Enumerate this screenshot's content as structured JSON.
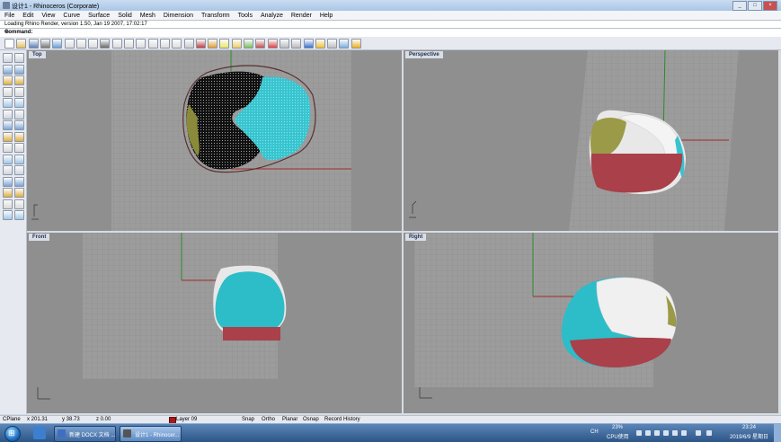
{
  "window": {
    "title": "设计1 - Rhinoceros (Corporate)",
    "minimize": "_",
    "maximize": "□",
    "close": "×"
  },
  "menu": [
    "File",
    "Edit",
    "View",
    "Curve",
    "Surface",
    "Solid",
    "Mesh",
    "Dimension",
    "Transform",
    "Tools",
    "Analyze",
    "Render",
    "Help"
  ],
  "command_history": "Loading Rhino Render, version 1.50, Jan 19 2007, 17:02:17",
  "command_prompt": "Command:",
  "toolbar_icons": [
    "new-icon",
    "open-icon",
    "save-icon",
    "print-icon",
    "export-icon",
    "cut-icon",
    "copy-icon",
    "paste-icon",
    "undo-icon",
    "pan-icon",
    "move-view-icon",
    "zoom-window-icon",
    "zoom-dynamic-icon",
    "zoom-extents-icon",
    "rotate-view-icon",
    "four-viewports-icon",
    "cplane-icon",
    "lock-grid-icon",
    "snap-icon",
    "light-icon",
    "material-icon",
    "render-icon",
    "color-wheel-icon",
    "shade-icon",
    "rendered-shade-icon",
    "sphere-icon",
    "display-icon",
    "options-icon",
    "properties-icon",
    "help-icon"
  ],
  "left_tool_icons": [
    "select-icon",
    "point-icon",
    "polyline-icon",
    "line-icon",
    "circle-icon",
    "ellipse-icon",
    "rectangle-icon",
    "polygon-icon",
    "arc-icon",
    "fillet-icon",
    "surface-icon",
    "extrude-icon",
    "box-icon",
    "sphere-tool-icon",
    "cylinder-icon",
    "mesh-icon",
    "boolean-icon",
    "split-icon",
    "trim-icon",
    "join-icon",
    "explode-icon",
    "group-icon",
    "move-icon",
    "copy-tool-icon",
    "rotate-icon",
    "scale-icon",
    "mirror-icon",
    "array-icon",
    "dimension-icon",
    "text-icon"
  ],
  "viewports": {
    "top": {
      "label": "Top"
    },
    "perspective": {
      "label": "Perspective"
    },
    "front": {
      "label": "Front"
    },
    "right": {
      "label": "Right"
    }
  },
  "status": {
    "cplane": "CPlane",
    "x": "x 201.31",
    "y": "y 38.73",
    "z": "z 0.00",
    "layer": "Layer 09",
    "snap": "Snap",
    "ortho": "Ortho",
    "planar": "Planar",
    "osnap": "Osnap",
    "record": "Record History"
  },
  "taskbar": {
    "btn1": "新建 DOCX 文档 ...",
    "btn2": "设计1 - Rhinocer...",
    "lang": "CH",
    "cpu_percent": "23%",
    "cpu_label": "CPU使用",
    "time": "23:24",
    "date": "2019/6/9 星期日"
  }
}
